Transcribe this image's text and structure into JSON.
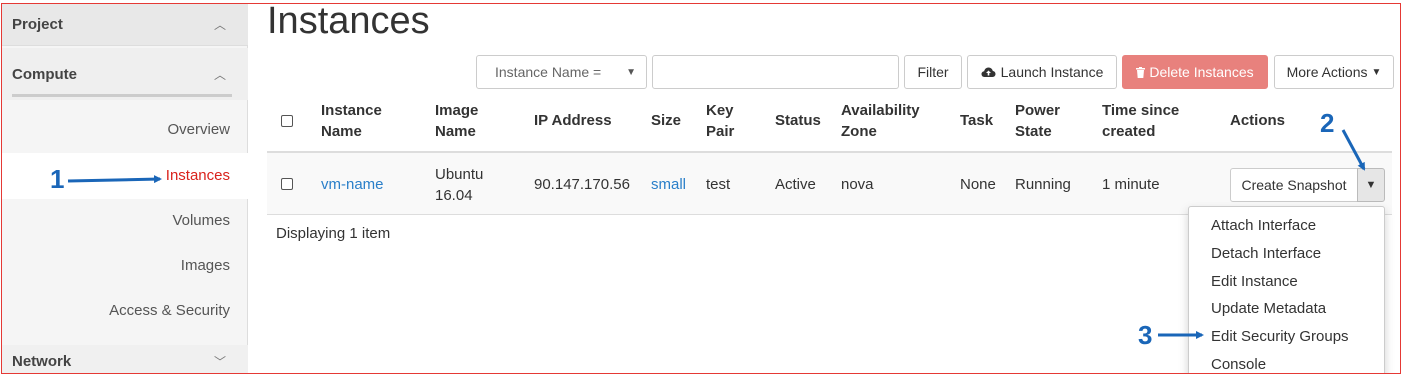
{
  "sidebar": {
    "project": "Project",
    "compute": "Compute",
    "items": [
      "Overview",
      "Instances",
      "Volumes",
      "Images",
      "Access & Security"
    ],
    "network": "Network",
    "active_color": "#d9231d"
  },
  "page": {
    "title": "Instances"
  },
  "toolbar": {
    "filter_select": "Instance Name =",
    "filter_value": "",
    "filter_button": "Filter",
    "launch_button": "Launch Instance",
    "delete_button": "Delete Instances",
    "more_actions": "More Actions"
  },
  "table": {
    "headers": {
      "name": [
        "Instance",
        "Name"
      ],
      "image": [
        "Image",
        "Name"
      ],
      "ip": "IP Address",
      "size": "Size",
      "keypair": [
        "Key",
        "Pair"
      ],
      "status": "Status",
      "az": [
        "Availability",
        "Zone"
      ],
      "task": "Task",
      "power": [
        "Power",
        "State"
      ],
      "time": [
        "Time since",
        "created"
      ],
      "actions": "Actions"
    },
    "rows": [
      {
        "name": "vm-name",
        "image": [
          "Ubuntu",
          "16.04"
        ],
        "ip": "90.147.170.56",
        "size": "small",
        "keypair": "test",
        "status": "Active",
        "az": "nova",
        "task": "None",
        "power": "Running",
        "time": "1 minute",
        "action": "Create Snapshot"
      }
    ],
    "footer": "Displaying 1 item"
  },
  "dropdown": {
    "items": [
      "Attach Interface",
      "Detach Interface",
      "Edit Instance",
      "Update Metadata",
      "Edit Security Groups",
      "Console"
    ]
  },
  "annotations": {
    "one": "1",
    "two": "2",
    "three": "3",
    "color": "#1a66b8"
  },
  "colors": {
    "frame_border": "#e53935",
    "link": "#2a7fc9",
    "danger": "#e8817d"
  }
}
